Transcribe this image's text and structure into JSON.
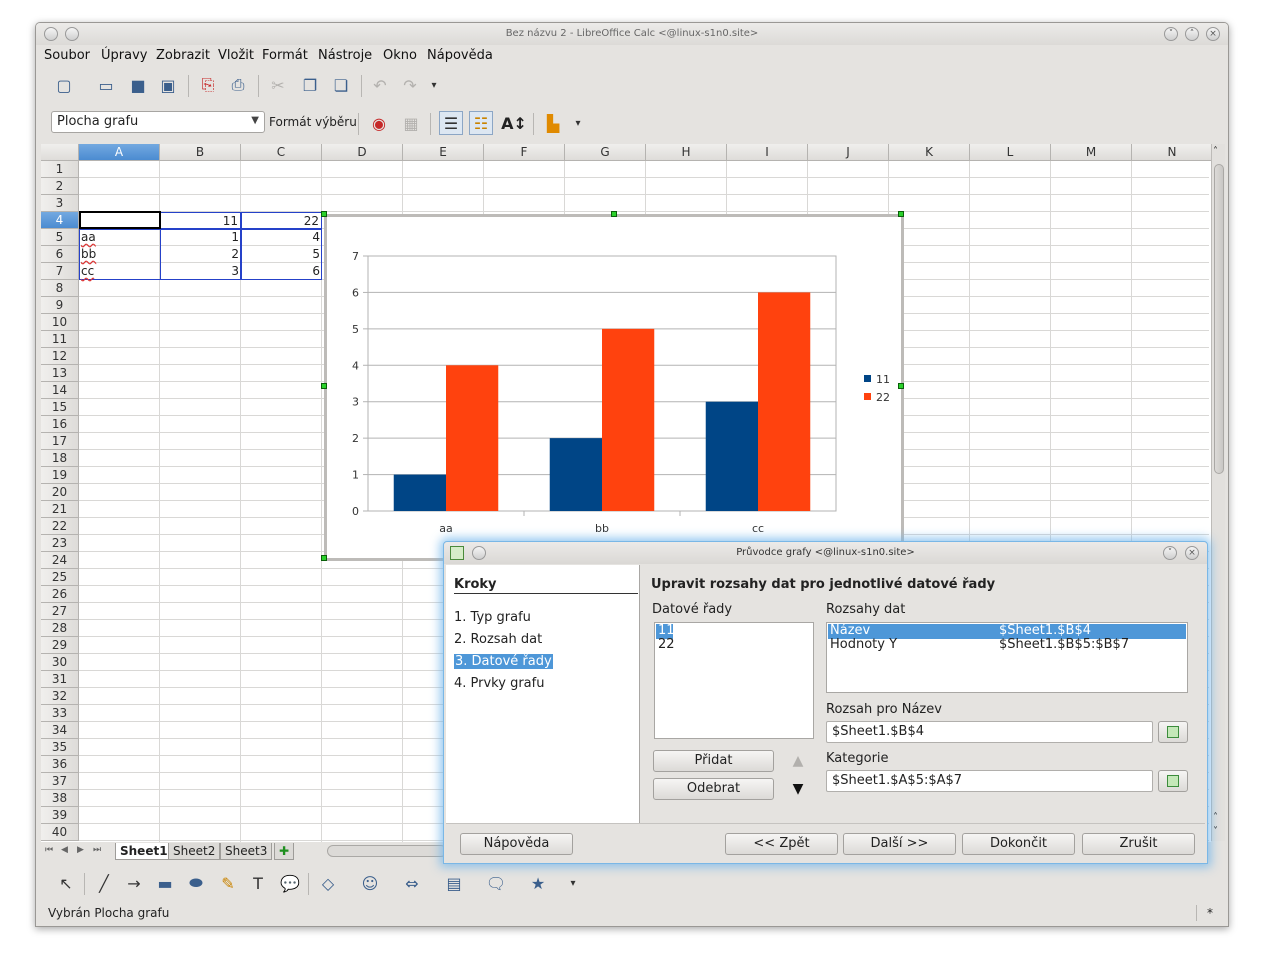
{
  "window": {
    "title": "Bez názvu 2 - LibreOffice Calc <@linux-s1n0.site>"
  },
  "menu": [
    "Soubor",
    "Úpravy",
    "Zobrazit",
    "Vložit",
    "Formát",
    "Nástroje",
    "Okno",
    "Nápověda"
  ],
  "format_toolbar": {
    "object_select": "Plocha grafu",
    "format_selection_label": "Formát výběru"
  },
  "sheet": {
    "columns": [
      "A",
      "B",
      "C",
      "D",
      "E",
      "F",
      "G",
      "H",
      "I",
      "J",
      "K",
      "L",
      "M",
      "N"
    ],
    "selected_column": "A",
    "selected_row": "4",
    "rows": [
      "1",
      "2",
      "3",
      "4",
      "5",
      "6",
      "7",
      "8",
      "9",
      "10",
      "11",
      "12",
      "13",
      "14",
      "15",
      "16",
      "17",
      "18",
      "19",
      "20",
      "21",
      "22",
      "23",
      "24",
      "25",
      "26",
      "27",
      "28",
      "29",
      "30",
      "31",
      "32",
      "33",
      "34",
      "35",
      "36",
      "37",
      "38",
      "39",
      "40"
    ],
    "cells": {
      "B4": "11",
      "C4": "22",
      "A5": "aa",
      "B5": "1",
      "C5": "4",
      "A6": "bb",
      "B6": "2",
      "C6": "5",
      "A7": "cc",
      "B7": "3",
      "C7": "6"
    },
    "tabs": [
      "Sheet1",
      "Sheet2",
      "Sheet3"
    ],
    "active_tab": "Sheet1"
  },
  "statusbar": {
    "text": "Vybrán Plocha grafu",
    "mark": "*"
  },
  "chart_data": {
    "type": "bar",
    "categories": [
      "aa",
      "bb",
      "cc"
    ],
    "series": [
      {
        "name": "11",
        "values": [
          1,
          2,
          3
        ],
        "color": "#004586"
      },
      {
        "name": "22",
        "values": [
          4,
          5,
          6
        ],
        "color": "#ff420e"
      }
    ],
    "ylim": [
      0,
      7
    ],
    "yticks": [
      "0",
      "1",
      "2",
      "3",
      "4",
      "5",
      "6",
      "7"
    ],
    "grid": true,
    "legend_position": "right"
  },
  "dialog": {
    "title": "Průvodce grafy <@linux-s1n0.site>",
    "steps_header": "Kroky",
    "steps": [
      "1. Typ grafu",
      "2. Rozsah dat",
      "3. Datové řady",
      "4. Prvky grafu"
    ],
    "active_step": 2,
    "heading": "Upravit rozsahy dat pro jednotlivé datové řady",
    "series_label": "Datové řady",
    "series_list": [
      "11",
      "22"
    ],
    "ranges_label": "Rozsahy dat",
    "ranges": [
      {
        "role": "Název",
        "range": "$Sheet1.$B$4"
      },
      {
        "role": "Hodnoty Y",
        "range": "$Sheet1.$B$5:$B$7"
      }
    ],
    "name_range_label": "Rozsah pro Název",
    "name_range_value": "$Sheet1.$B$4",
    "categories_label": "Kategorie",
    "categories_value": "$Sheet1.$A$5:$A$7",
    "add_button": "Přidat",
    "remove_button": "Odebrat",
    "help_button": "Nápověda",
    "back_button": "<< Zpět",
    "next_button": "Další >>",
    "finish_button": "Dokončit",
    "cancel_button": "Zrušit"
  }
}
